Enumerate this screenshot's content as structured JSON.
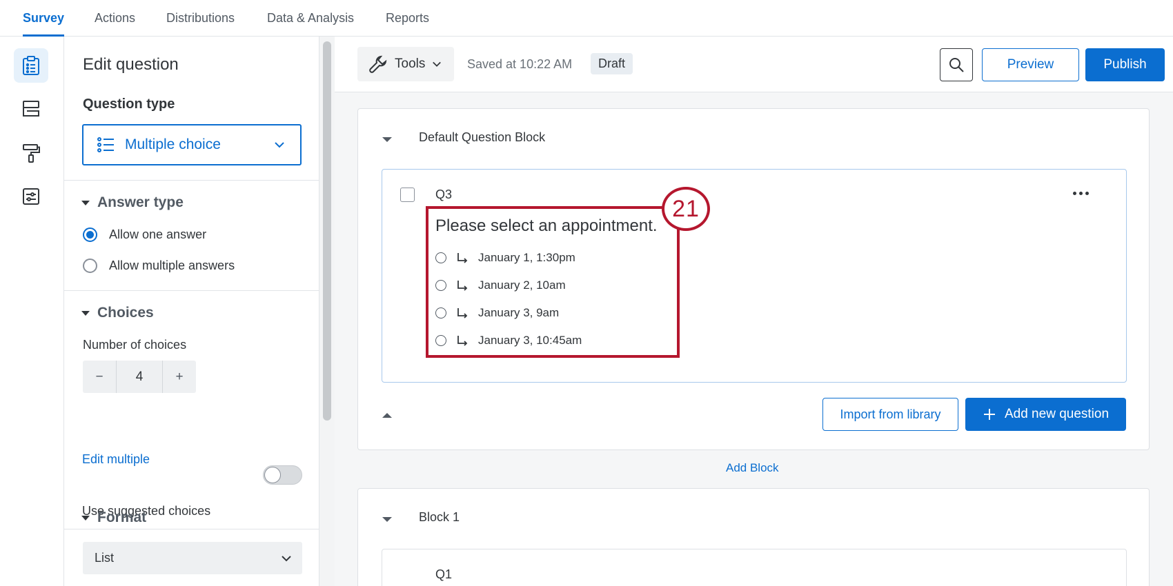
{
  "nav": {
    "tabs": [
      "Survey",
      "Actions",
      "Distributions",
      "Data & Analysis",
      "Reports"
    ],
    "active": "Survey"
  },
  "rail": {
    "icons": [
      "survey-icon",
      "survey-flow-icon",
      "look-and-feel-icon",
      "survey-options-icon"
    ]
  },
  "panel": {
    "title": "Edit question",
    "question_type_label": "Question type",
    "question_type_value": "Multiple choice",
    "answer_type": {
      "heading": "Answer type",
      "options": [
        "Allow one answer",
        "Allow multiple answers"
      ],
      "selected": "Allow one answer"
    },
    "choices": {
      "heading": "Choices",
      "number_label": "Number of choices",
      "number_value": "4",
      "minus": "−",
      "plus": "+",
      "edit_multiple": "Edit multiple",
      "suggested_label": "Use suggested choices",
      "suggested_on": false
    },
    "format": {
      "heading": "Format",
      "value": "List"
    }
  },
  "toolbar": {
    "tools_label": "Tools",
    "saved_text": "Saved at 10:22 AM",
    "draft_badge": "Draft",
    "preview_label": "Preview",
    "publish_label": "Publish"
  },
  "block_default": {
    "title": "Default Question Block",
    "question": {
      "number": "Q3",
      "text": "Please select an appointment.",
      "choices": [
        "January 1, 1:30pm",
        "January 2, 10am",
        "January 3, 9am",
        "January 3, 10:45am"
      ]
    },
    "import_label": "Import from library",
    "add_question_label": "Add new question"
  },
  "add_block_label": "Add Block",
  "block_1": {
    "title": "Block 1",
    "question_number": "Q1"
  },
  "annotation": {
    "step": "21",
    "color": "#b5172e"
  },
  "colors": {
    "accent": "#0b6ed0",
    "annotation": "#b5172e"
  }
}
